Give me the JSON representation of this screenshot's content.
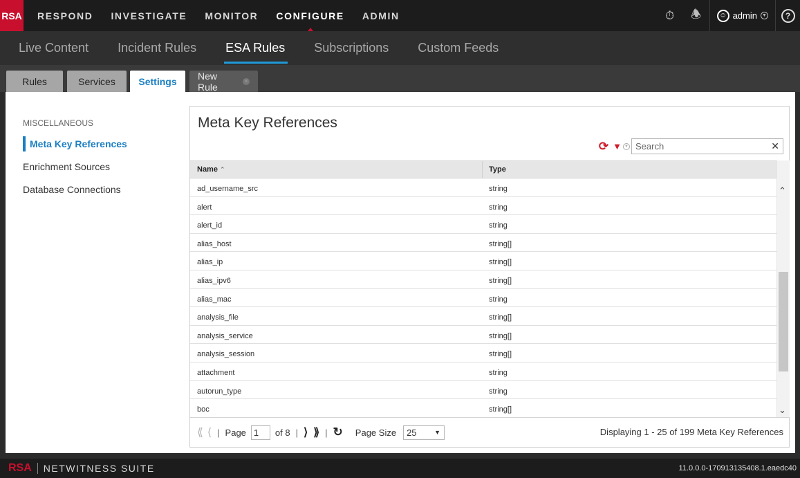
{
  "topnav": {
    "logo": "RSA",
    "items": [
      {
        "label": "RESPOND",
        "active": false
      },
      {
        "label": "INVESTIGATE",
        "active": false
      },
      {
        "label": "MONITOR",
        "active": false
      },
      {
        "label": "CONFIGURE",
        "active": true
      },
      {
        "label": "ADMIN",
        "active": false
      }
    ],
    "user": "admin",
    "icons": [
      "stopwatch-icon",
      "bell-icon",
      "user-icon",
      "help-icon"
    ],
    "help": "?"
  },
  "subnav": {
    "items": [
      {
        "label": "Live Content",
        "active": false
      },
      {
        "label": "Incident Rules",
        "active": false
      },
      {
        "label": "ESA Rules",
        "active": true
      },
      {
        "label": "Subscriptions",
        "active": false
      },
      {
        "label": "Custom Feeds",
        "active": false
      }
    ]
  },
  "tabs": [
    {
      "label": "Rules",
      "active": false
    },
    {
      "label": "Services",
      "active": false
    },
    {
      "label": "Settings",
      "active": true
    },
    {
      "label": "New Rule",
      "active": false,
      "closable": true
    }
  ],
  "sidebar": {
    "heading": "MISCELLANEOUS",
    "items": [
      {
        "label": "Meta Key References",
        "active": true
      },
      {
        "label": "Enrichment Sources",
        "active": false
      },
      {
        "label": "Database Connections",
        "active": false
      }
    ]
  },
  "panel": {
    "title": "Meta Key References",
    "search": {
      "placeholder": "Search",
      "value": ""
    },
    "columns": {
      "name": "Name",
      "type": "Type"
    },
    "rows": [
      {
        "name": "ad_username_src",
        "type": "string"
      },
      {
        "name": "alert",
        "type": "string"
      },
      {
        "name": "alert_id",
        "type": "string"
      },
      {
        "name": "alias_host",
        "type": "string[]"
      },
      {
        "name": "alias_ip",
        "type": "string[]"
      },
      {
        "name": "alias_ipv6",
        "type": "string[]"
      },
      {
        "name": "alias_mac",
        "type": "string"
      },
      {
        "name": "analysis_file",
        "type": "string[]"
      },
      {
        "name": "analysis_service",
        "type": "string[]"
      },
      {
        "name": "analysis_session",
        "type": "string[]"
      },
      {
        "name": "attachment",
        "type": "string"
      },
      {
        "name": "autorun_type",
        "type": "string"
      },
      {
        "name": "boc",
        "type": "string[]"
      }
    ],
    "pager": {
      "page_label": "Page",
      "page": "1",
      "of_label": "of 8",
      "page_size_label": "Page Size",
      "page_size": "25",
      "summary": "Displaying 1 - 25 of 199 Meta Key References"
    }
  },
  "footer": {
    "logo": "RSA",
    "product": "NETWITNESS SUITE",
    "version": "11.0.0.0-170913135408.1.eaedc40"
  },
  "colors": {
    "brand_red": "#c8102e",
    "accent_blue": "#1b7fc2",
    "active_underline": "#1f9ad8"
  }
}
